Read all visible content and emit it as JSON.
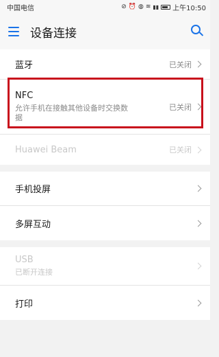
{
  "status_bar": {
    "carrier": "中国电信",
    "time": "上午10:50",
    "icons": [
      "mute-icon",
      "alarm-icon",
      "vibrate-icon",
      "wifi-icon",
      "signal-icon",
      "battery-icon"
    ]
  },
  "header": {
    "title": "设备连接",
    "menu_icon": "menu-icon",
    "search_icon": "search-icon",
    "accent_color": "#1a73e8"
  },
  "group1": [
    {
      "label": "蓝牙",
      "status": "已关闭",
      "disabled": false
    },
    {
      "label": "NFC",
      "subtitle": "允许手机在接触其他设备时交换数据",
      "status": "已关闭",
      "disabled": false
    },
    {
      "label": "Huawei Beam",
      "status": "已关闭",
      "disabled": true
    }
  ],
  "group2": [
    {
      "label": "手机投屏"
    },
    {
      "label": "多屏互动"
    }
  ],
  "group3": [
    {
      "label": "USB",
      "subtitle": "已断开连接",
      "disabled": true
    },
    {
      "label": "打印"
    }
  ],
  "highlight_color": "#c8101c"
}
